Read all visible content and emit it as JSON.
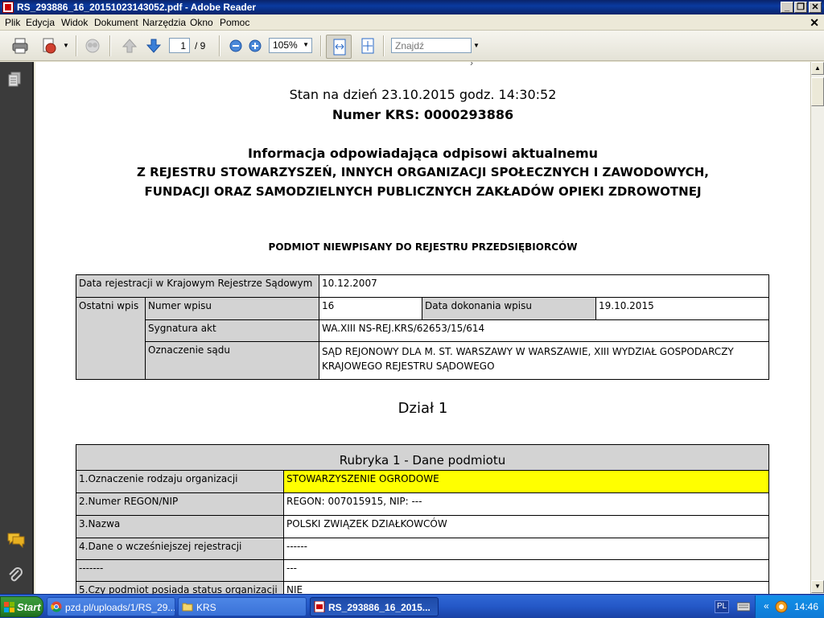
{
  "window": {
    "title": "RS_293886_16_20151023143052.pdf - Adobe Reader"
  },
  "menu": [
    "Plik",
    "Edycja",
    "Widok",
    "Dokument",
    "Narzędzia",
    "Okno",
    "Pomoc"
  ],
  "toolbar": {
    "page_current": "1",
    "page_total": "/ 9",
    "zoom": "105%",
    "find_placeholder": "Znajdź"
  },
  "document": {
    "status_line": "Stan na dzień 23.10.2015 godz. 14:30:52",
    "krs_number": "Numer KRS: 0000293886",
    "heading_line1": "Informacja odpowiadająca odpisowi aktualnemu",
    "heading_line2": "Z REJESTRU STOWARZYSZEŃ, INNYCH ORGANIZACJI SPOŁECZNYCH I ZAWODOWYCH,",
    "heading_line3": "FUNDACJI ORAZ SAMODZIELNYCH PUBLICZNYCH ZAKŁADÓW OPIEKI ZDROWOTNEJ",
    "subheading": "PODMIOT NIEWPISANY DO REJESTRU PRZEDSIĘBIORCÓW",
    "reg_table": {
      "reg_date_label": "Data rejestracji w Krajowym Rejestrze Sądowym",
      "reg_date_value": "10.12.2007",
      "last_entry_label": "Ostatni wpis",
      "entry_no_label": "Numer wpisu",
      "entry_no_value": "16",
      "entry_date_label": "Data dokonania wpisu",
      "entry_date_value": "19.10.2015",
      "signature_label": "Sygnatura akt",
      "signature_value": "WA.XIII NS-REJ.KRS/62653/15/614",
      "court_label": "Oznaczenie sądu",
      "court_value": "SĄD REJONOWY DLA M. ST. WARSZAWY W WARSZAWIE, XIII WYDZIAŁ GOSPODARCZY KRAJOWEGO REJESTRU SĄDOWEGO"
    },
    "section_title": "Dział 1",
    "rubric": {
      "title": "Rubryka 1 - Dane podmiotu",
      "rows": [
        {
          "label": "1.Oznaczenie rodzaju organizacji",
          "value": "STOWARZYSZENIE OGRODOWE"
        },
        {
          "label": "2.Numer REGON/NIP",
          "value": "REGON: 007015915, NIP: ---"
        },
        {
          "label": "3.Nazwa",
          "value": "POLSKI ZWIĄZEK DZIAŁKOWCÓW"
        },
        {
          "label": "4.Dane o wcześniejszej rejestracji",
          "value": "------"
        },
        {
          "label": "-------",
          "value": "---"
        },
        {
          "label": "5.Czy podmiot posiada status organizacji",
          "value": "NIE"
        }
      ]
    }
  },
  "taskbar": {
    "start_label": "Start",
    "tasks": [
      {
        "label": "pzd.pl/uploads/1/RS_29..."
      },
      {
        "label": "KRS"
      },
      {
        "label": "RS_293886_16_2015..."
      }
    ],
    "lang": "PL",
    "clock": "14:46"
  },
  "colors": {
    "highlight_yellow": "#ffff00",
    "table_gray": "#d3d3d3",
    "panel_dark": "#3b3b3b"
  }
}
